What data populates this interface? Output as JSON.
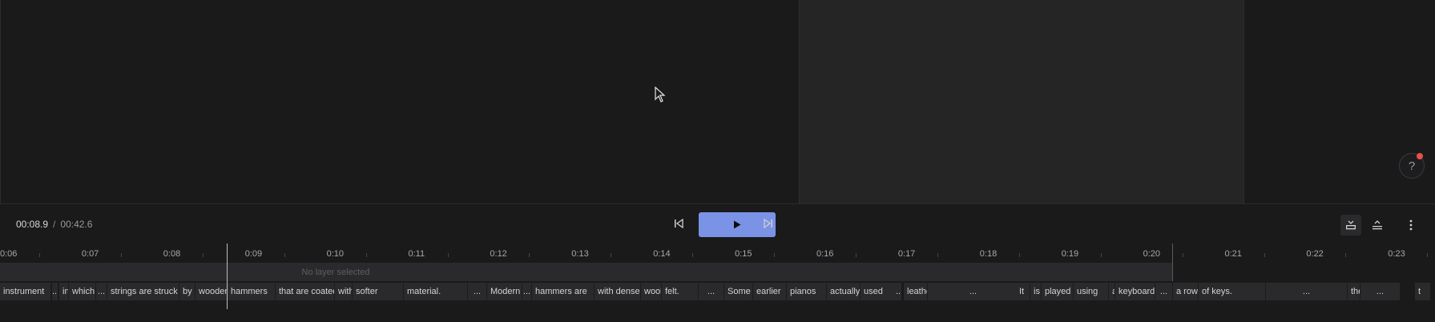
{
  "player": {
    "current_time": "00:08.9",
    "separator": "/",
    "total_time": "00:42.6"
  },
  "help": {
    "label": "?"
  },
  "timeline": {
    "ticks": [
      "0:06",
      "0:07",
      "0:08",
      "0:09",
      "0:10",
      "0:11",
      "0:12",
      "0:13",
      "0:14",
      "0:15",
      "0:16",
      "0:17",
      "0:18",
      "0:19",
      "0:20",
      "0:21",
      "0:22",
      "0:23"
    ],
    "layer_placeholder": "No layer selected",
    "words": [
      "instrument",
      "...",
      "in",
      "which",
      "...",
      "strings are struck",
      "by",
      "wooden",
      "hammers",
      "that are coated",
      "with",
      "softer",
      "material.",
      "...",
      "Modern",
      "...",
      "hammers are",
      "with dense",
      "wool",
      "felt.",
      "...",
      "Some",
      "earlier",
      "pianos",
      "actually",
      "used",
      "...",
      "leather",
      "...",
      "It",
      "is",
      "played",
      "using",
      "a",
      "keyboard",
      "...",
      "a row",
      "of keys.",
      "...",
      "the",
      "...",
      "t"
    ]
  },
  "colors": {
    "accent": "#7b93e6",
    "notification": "#e8504a",
    "background": "#1a1a1b",
    "panel": "#252526"
  },
  "icons": {
    "cursor": "arrow-pointer-icon",
    "skip_back": "skip-back-icon",
    "play": "play-icon",
    "skip_forward": "skip-forward-icon",
    "fit_view": "fit-view-icon",
    "collapse": "collapse-icon",
    "more": "more-vertical-icon"
  }
}
